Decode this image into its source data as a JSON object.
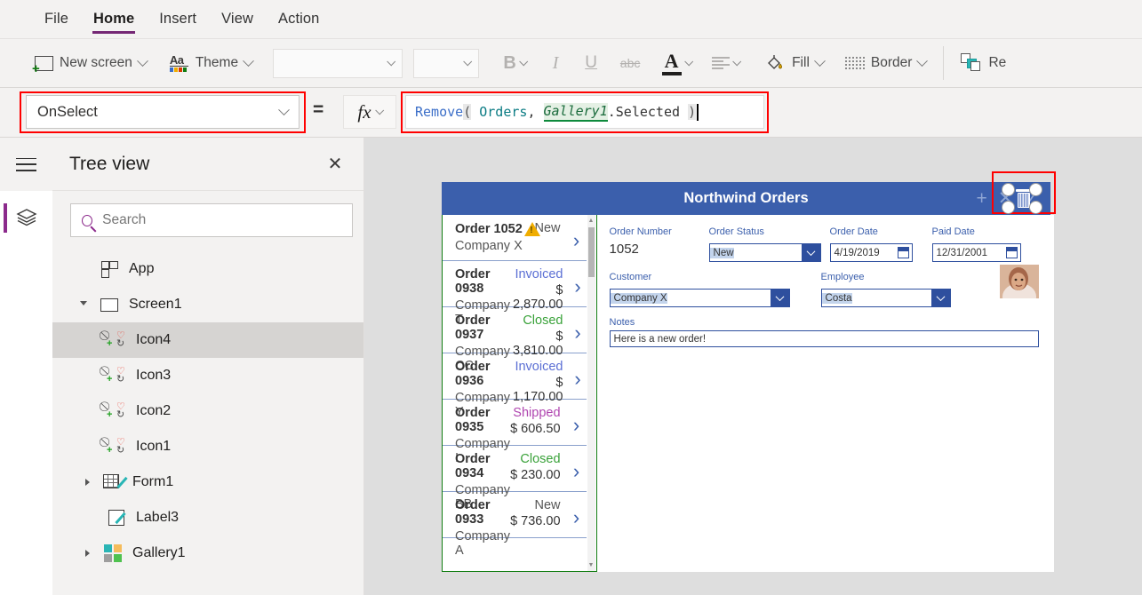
{
  "menu": {
    "items": [
      {
        "label": "File",
        "active": false
      },
      {
        "label": "Home",
        "active": true
      },
      {
        "label": "Insert",
        "active": false
      },
      {
        "label": "View",
        "active": false
      },
      {
        "label": "Action",
        "active": false
      }
    ]
  },
  "ribbon": {
    "new_screen": "New screen",
    "theme": "Theme",
    "font_family_value": "",
    "font_size_value": "",
    "bold": "B",
    "italic": "I",
    "underline": "U",
    "strikethrough": "abc",
    "font_color": "A",
    "fill": "Fill",
    "border": "Border",
    "reorder": "Re"
  },
  "formula_bar": {
    "property": "OnSelect",
    "equals": "=",
    "fx": "fx",
    "formula_tokens": [
      {
        "text": "Remove",
        "type": "function"
      },
      {
        "text": "(",
        "type": "paren"
      },
      {
        "text": " Orders",
        "type": "table"
      },
      {
        "text": ", ",
        "type": "plain"
      },
      {
        "text": "Gallery1",
        "type": "control"
      },
      {
        "text": ".Selected ",
        "type": "property"
      },
      {
        "text": ")",
        "type": "paren"
      }
    ],
    "formula_text": "Remove( Orders, Gallery1.Selected )",
    "highlight_color": "#ff0000"
  },
  "tree_panel": {
    "title": "Tree view",
    "close": "✕",
    "search_placeholder": "Search",
    "search_value": "",
    "items": [
      {
        "label": "App",
        "icon": "app-icon",
        "indent": 0,
        "expander": "none",
        "selected": false
      },
      {
        "label": "Screen1",
        "icon": "screen-icon",
        "indent": 0,
        "expander": "open",
        "selected": false
      },
      {
        "label": "Icon4",
        "icon": "icon-control-icon",
        "indent": 1,
        "expander": "none",
        "selected": true
      },
      {
        "label": "Icon3",
        "icon": "icon-control-icon",
        "indent": 1,
        "expander": "none",
        "selected": false
      },
      {
        "label": "Icon2",
        "icon": "icon-control-icon",
        "indent": 1,
        "expander": "none",
        "selected": false
      },
      {
        "label": "Icon1",
        "icon": "icon-control-icon",
        "indent": 1,
        "expander": "none",
        "selected": false
      },
      {
        "label": "Form1",
        "icon": "form-icon",
        "indent": 1,
        "expander": "closed",
        "selected": false
      },
      {
        "label": "Label3",
        "icon": "label-icon",
        "indent": 1,
        "expander": "none",
        "selected": false
      },
      {
        "label": "Gallery1",
        "icon": "gallery-icon",
        "indent": 1,
        "expander": "closed",
        "selected": false
      }
    ]
  },
  "app_preview": {
    "title": "Northwind Orders",
    "header_color": "#3b5fac",
    "header_tools": [
      "+",
      "✕",
      "✓"
    ],
    "selected_control": "trash-icon",
    "gallery": {
      "rows": [
        {
          "order": "Order 1052",
          "company": "Company X",
          "status": "New",
          "status_color": "#555555",
          "amount": "",
          "warning": true
        },
        {
          "order": "Order 0938",
          "company": "Company T",
          "status": "Invoiced",
          "status_color": "#5b6fd4",
          "amount": "$ 2,870.00",
          "warning": false
        },
        {
          "order": "Order 0937",
          "company": "Company CC",
          "status": "Closed",
          "status_color": "#3aa23a",
          "amount": "$ 3,810.00",
          "warning": false
        },
        {
          "order": "Order 0936",
          "company": "Company Y",
          "status": "Invoiced",
          "status_color": "#5b6fd4",
          "amount": "$ 1,170.00",
          "warning": false
        },
        {
          "order": "Order 0935",
          "company": "Company I",
          "status": "Shipped",
          "status_color": "#b045b0",
          "amount": "$ 606.50",
          "warning": false
        },
        {
          "order": "Order 0934",
          "company": "Company BB",
          "status": "Closed",
          "status_color": "#3aa23a",
          "amount": "$ 230.00",
          "warning": false
        },
        {
          "order": "Order 0933",
          "company": "Company A",
          "status": "New",
          "status_color": "#555555",
          "amount": "$ 736.00",
          "warning": false
        }
      ]
    },
    "form": {
      "order_number_label": "Order Number",
      "order_number_value": "1052",
      "order_status_label": "Order Status",
      "order_status_value": "New",
      "order_date_label": "Order Date",
      "order_date_value": "4/19/2019",
      "paid_date_label": "Paid Date",
      "paid_date_value": "12/31/2001",
      "customer_label": "Customer",
      "customer_value": "Company X",
      "employee_label": "Employee",
      "employee_value": "Costa",
      "notes_label": "Notes",
      "notes_value": "Here is a new order!"
    }
  }
}
